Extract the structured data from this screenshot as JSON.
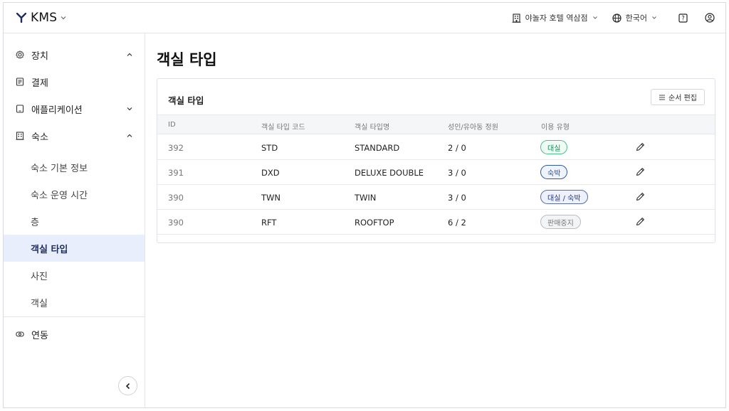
{
  "header": {
    "brand": "KMS",
    "hotel": "야놀자 호텔 역삼점",
    "language": "한국어"
  },
  "sidebar": {
    "items": [
      {
        "label": "장치",
        "icon": "gear-icon"
      },
      {
        "label": "결제",
        "icon": "receipt-icon"
      },
      {
        "label": "애플리케이션",
        "icon": "tablet-icon"
      },
      {
        "label": "숙소",
        "icon": "building-icon"
      },
      {
        "label": "연동",
        "icon": "link-icon"
      }
    ],
    "sub_items": [
      {
        "label": "숙소 기본 정보"
      },
      {
        "label": "숙소 운영 시간"
      },
      {
        "label": "층"
      },
      {
        "label": "객실 타입"
      },
      {
        "label": "사진"
      },
      {
        "label": "객실"
      }
    ],
    "active_sub_item": "객실 타입"
  },
  "main": {
    "title": "객실 타입",
    "card_title": "객실 타입",
    "edit_order_label": "순서 편집",
    "columns": [
      "ID",
      "객실 타입 코드",
      "객실 타입명",
      "성인/유아동 정원",
      "이용 유형"
    ],
    "rows": [
      {
        "id": "392",
        "code": "STD",
        "name": "STANDARD",
        "capacity": "2 / 0",
        "usage": "대실",
        "usage_style": "green"
      },
      {
        "id": "391",
        "code": "DXD",
        "name": "DELUXE DOUBLE",
        "capacity": "3 / 0",
        "usage": "숙박",
        "usage_style": "blue"
      },
      {
        "id": "390",
        "code": "TWN",
        "name": "TWIN",
        "capacity": "3 / 0",
        "usage": "대실 / 숙박",
        "usage_style": "navy"
      },
      {
        "id": "390",
        "code": "RFT",
        "name": "ROOFTOP",
        "capacity": "6 / 2",
        "usage": "판매중지",
        "usage_style": "gray"
      }
    ]
  },
  "colors": {
    "active_bg": "#e8eefb",
    "border": "#e3e5e8",
    "badge_green": "#4cc08a",
    "badge_blue": "#2f5aa8",
    "badge_gray": "#b9bcc3"
  }
}
